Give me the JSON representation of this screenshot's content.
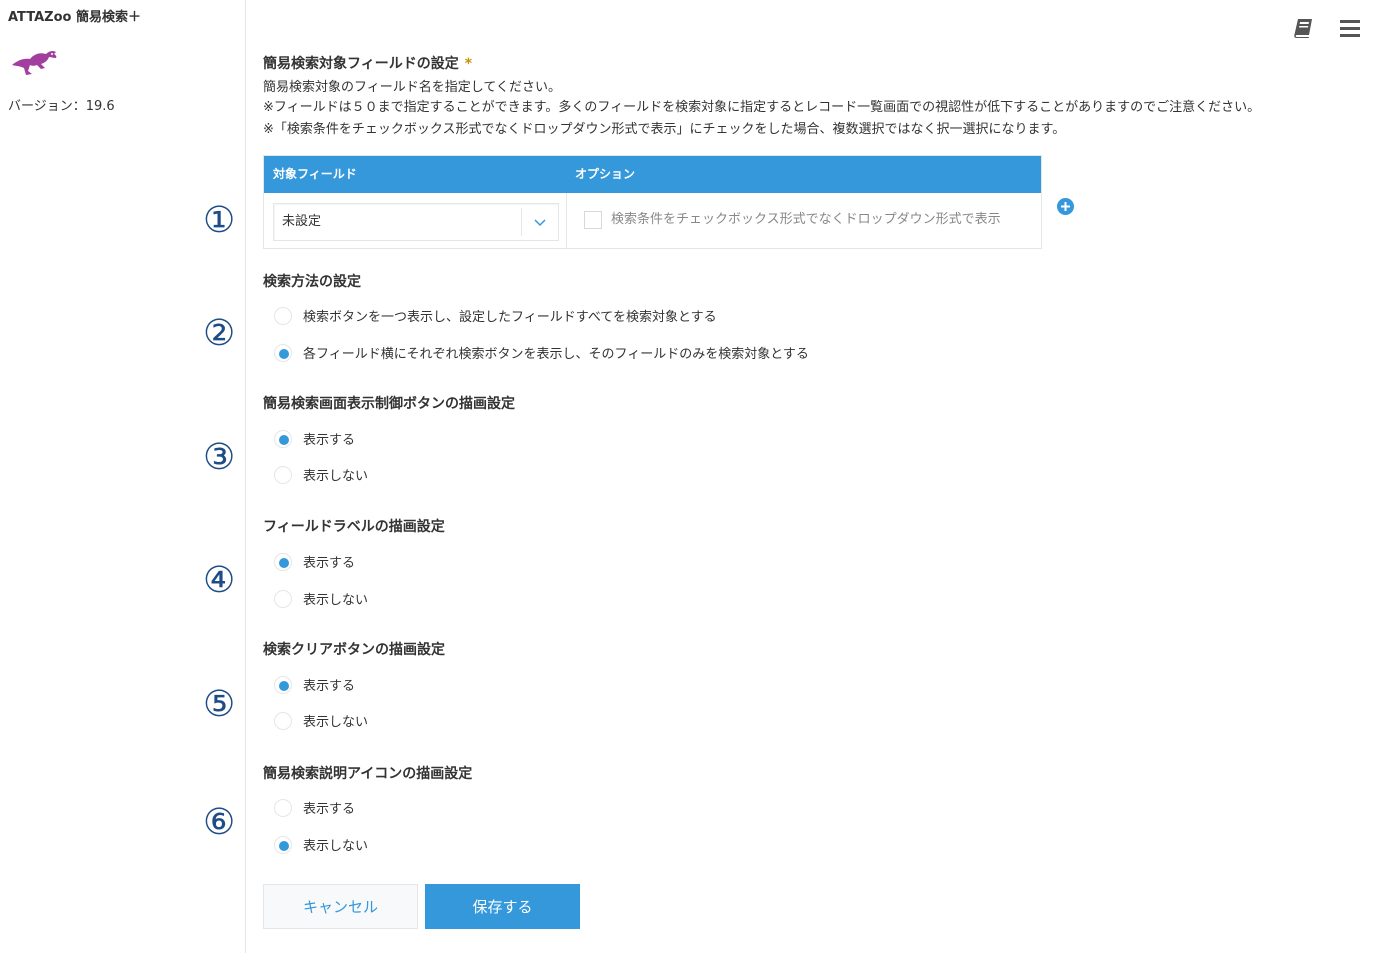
{
  "sidebar": {
    "app_title": "ATTAZoo 簡易検索＋",
    "version": "バージョン：19.6"
  },
  "colors": {
    "accent": "#3498db",
    "logo": "#a23e9e",
    "number_marker": "#1d4d86",
    "required_mark": "#c1930a"
  },
  "header_icons": [
    "book-icon",
    "menu-icon"
  ],
  "field_section": {
    "title": "簡易検索対象フィールドの設定",
    "required_mark": "*",
    "desc_1": "簡易検索対象のフィールド名を指定してください。",
    "desc_2": "※フィールドは５０まで指定することができます。多くのフィールドを検索対象に指定するとレコード一覧画面での視認性が低下することがありますのでご注意ください。",
    "desc_3": "※「検索条件をチェックボックス形式でなくドロップダウン形式で表示」にチェックをした場合、複数選択ではなく択一選択になります。",
    "table": {
      "col_field": "対象フィールド",
      "col_option": "オプション",
      "row": {
        "field_value": "未設定",
        "option_label": "検索条件をチェックボックス形式でなくドロップダウン形式で表示",
        "option_checked": false
      }
    }
  },
  "markers": [
    "①",
    "②",
    "③",
    "④",
    "⑤",
    "⑥"
  ],
  "search_method": {
    "title": "検索方法の設定",
    "options": [
      {
        "label": "検索ボタンを一つ表示し、設定したフィールドすべてを検索対象とする",
        "selected": false
      },
      {
        "label": "各フィールド横にそれぞれ検索ボタンを表示し、そのフィールドのみを検索対象とする",
        "selected": true
      }
    ]
  },
  "toggle_button_section": {
    "title": "簡易検索画面表示制御ボタンの描画設定",
    "options": [
      {
        "label": "表示する",
        "selected": true
      },
      {
        "label": "表示しない",
        "selected": false
      }
    ]
  },
  "field_label_section": {
    "title": "フィールドラベルの描画設定",
    "options": [
      {
        "label": "表示する",
        "selected": true
      },
      {
        "label": "表示しない",
        "selected": false
      }
    ]
  },
  "clear_button_section": {
    "title": "検索クリアボタンの描画設定",
    "options": [
      {
        "label": "表示する",
        "selected": true
      },
      {
        "label": "表示しない",
        "selected": false
      }
    ]
  },
  "help_icon_section": {
    "title": "簡易検索説明アイコンの描画設定",
    "options": [
      {
        "label": "表示する",
        "selected": false
      },
      {
        "label": "表示しない",
        "selected": true
      }
    ]
  },
  "buttons": {
    "cancel": "キャンセル",
    "save": "保存する"
  }
}
